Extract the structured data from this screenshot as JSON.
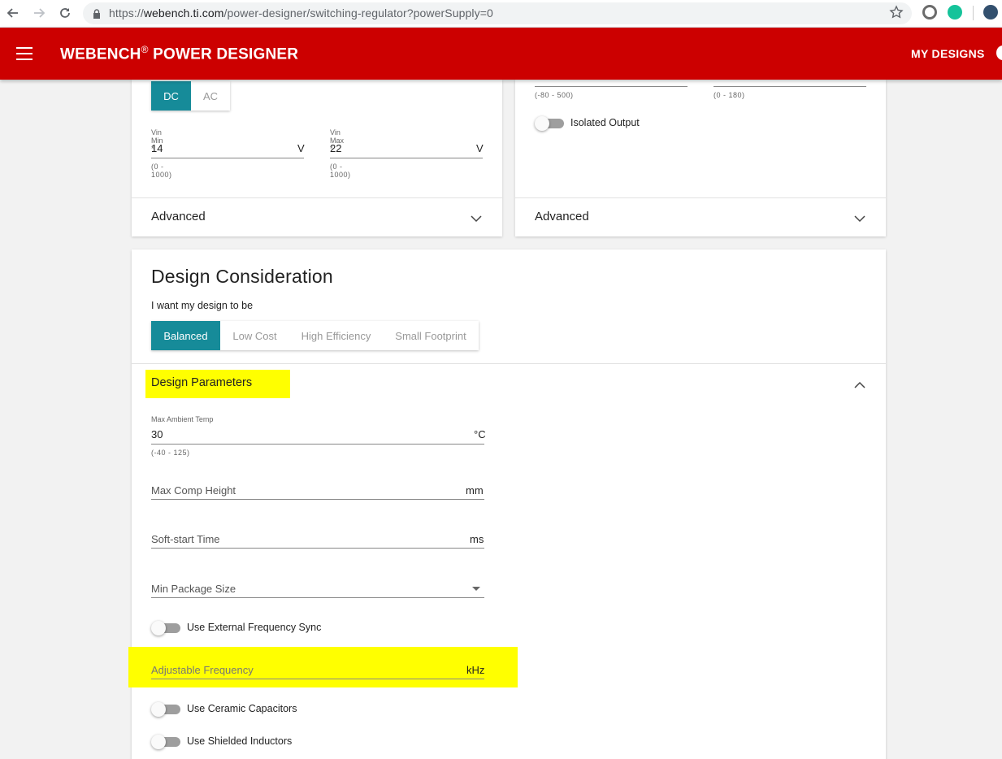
{
  "browser": {
    "url_prefix": "https://",
    "url_host": "webench.ti.com",
    "url_path": "/power-designer/switching-regulator?powerSupply=0"
  },
  "header": {
    "title": "WEBENCH",
    "title_mark": "®",
    "title_rest": " POWER DESIGNER",
    "my_designs": "MY DESIGNS"
  },
  "input_card": {
    "source_types": [
      "DC",
      "AC"
    ],
    "active_source": "DC",
    "vin_min": {
      "label": "Vin Min *",
      "value": "14",
      "unit": "V",
      "range": "(0 - 1000)"
    },
    "vin_max": {
      "label": "Vin Max *",
      "value": "22",
      "unit": "V",
      "range": "(0 - 1000)"
    },
    "advanced": "Advanced"
  },
  "output_card": {
    "range_left": "(-80 - 500)",
    "range_right": "(0 - 180)",
    "isolated_output": "Isolated Output",
    "advanced": "Advanced"
  },
  "design_consideration": {
    "title": "Design Consideration",
    "subtitle": "I want my design to be",
    "options": [
      "Balanced",
      "Low Cost",
      "High Efficiency",
      "Small Footprint"
    ],
    "selected": "Balanced"
  },
  "design_parameters": {
    "title": "Design Parameters",
    "max_ambient_temp": {
      "label": "Max Ambient Temp",
      "value": "30",
      "unit": "°C",
      "range": "(-40 - 125)"
    },
    "max_comp_height": {
      "label": "Max Comp Height",
      "unit": "mm"
    },
    "soft_start_time": {
      "label": "Soft-start Time",
      "unit": "ms"
    },
    "min_package_size": {
      "label": "Min Package Size"
    },
    "use_external_frequency_sync": "Use External Frequency Sync",
    "adjustable_frequency": {
      "label": "Adjustable Frequency",
      "unit": "kHz"
    },
    "use_ceramic_capacitors": "Use Ceramic Capacitors",
    "use_shielded_inductors": "Use Shielded Inductors"
  },
  "colors": {
    "header_red": "#cc0000",
    "teal_active": "#168b99",
    "highlight": "#ffff00"
  }
}
